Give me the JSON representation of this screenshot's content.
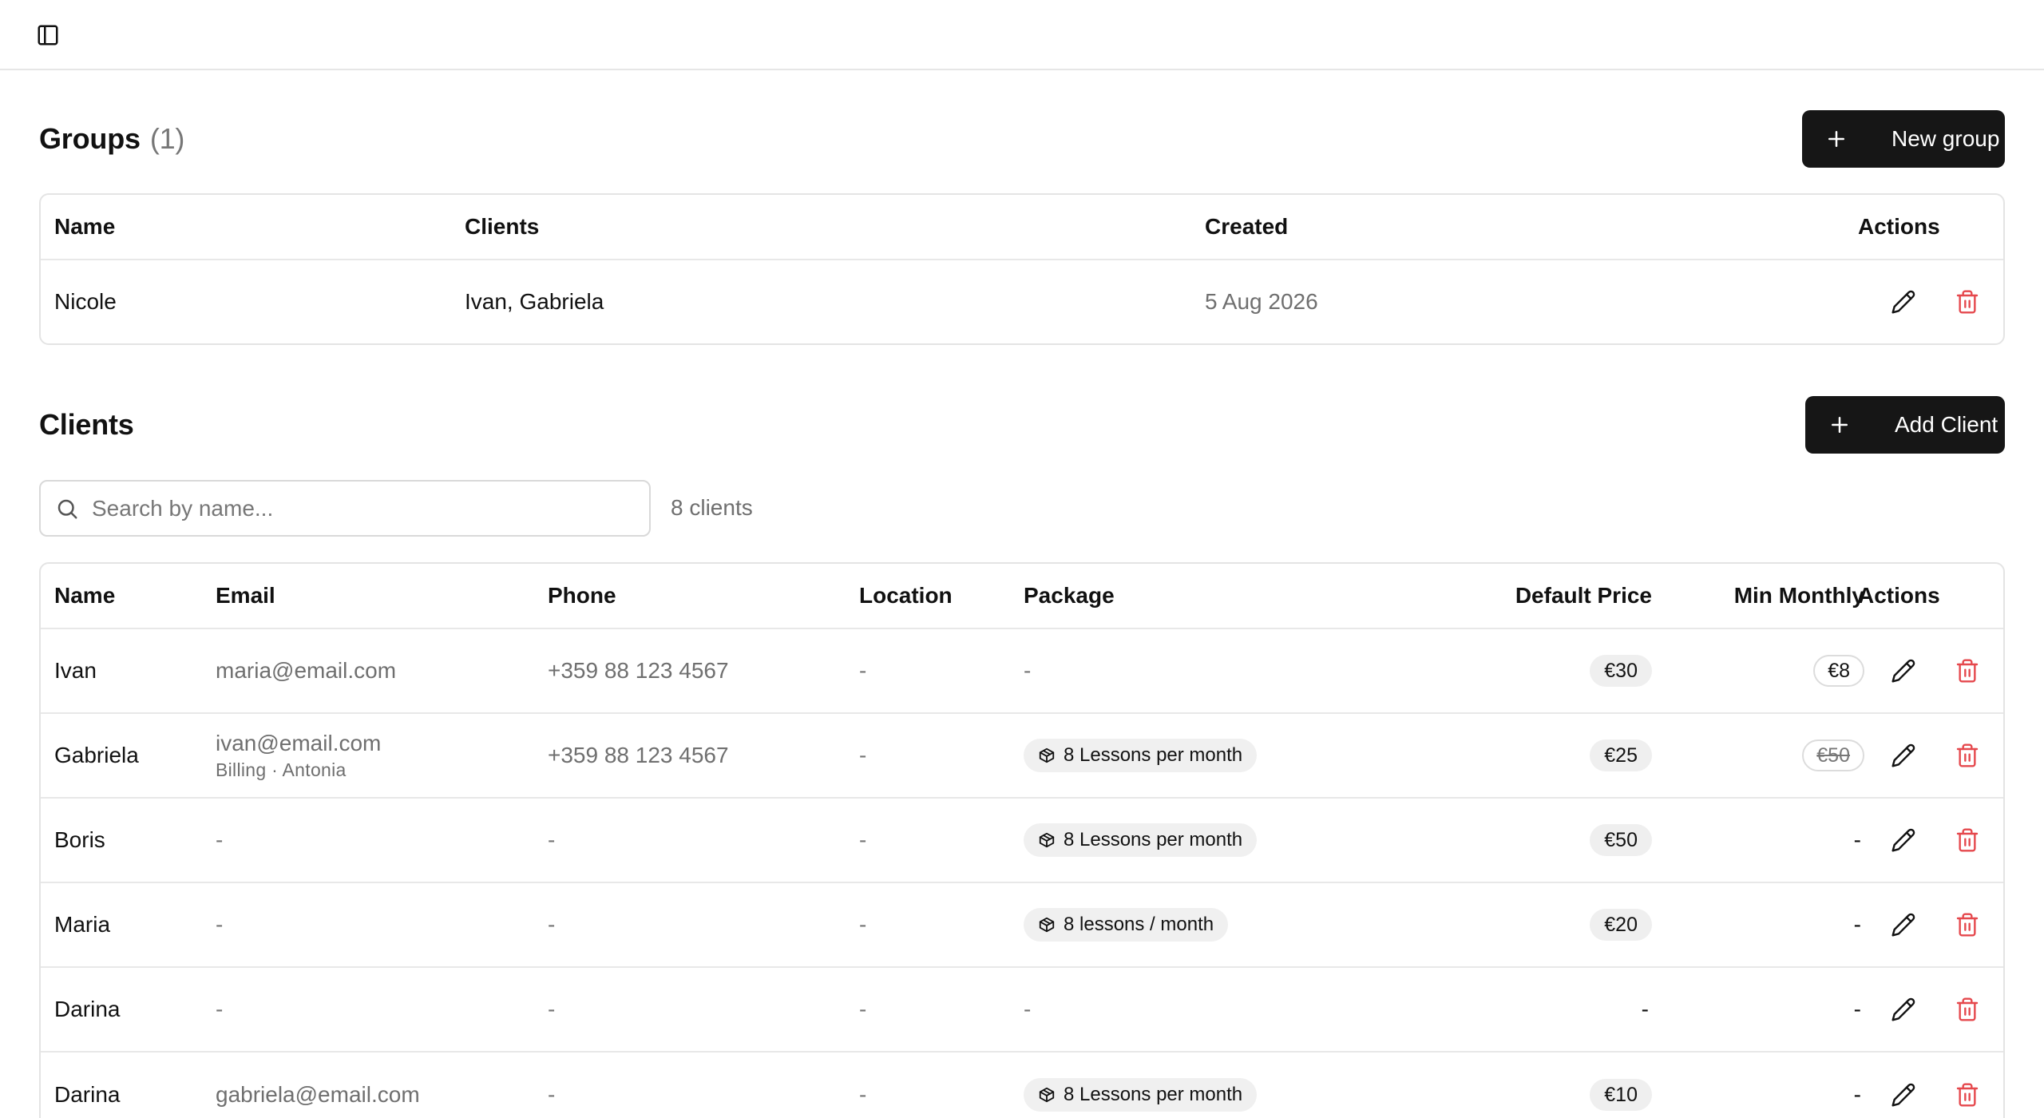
{
  "topbar": {
    "toggle_icon": "sidebar-toggle-icon"
  },
  "groups": {
    "title": "Groups",
    "count": "(1)",
    "new_button": "New group",
    "columns": {
      "name": "Name",
      "clients": "Clients",
      "created": "Created",
      "actions": "Actions"
    },
    "rows": [
      {
        "name": "Nicole",
        "clients": "Ivan, Gabriela",
        "created": "5 Aug 2026"
      }
    ]
  },
  "clients": {
    "title": "Clients",
    "add_button": "Add Client",
    "search_placeholder": "Search by name...",
    "count_label": "8 clients",
    "columns": {
      "name": "Name",
      "email": "Email",
      "phone": "Phone",
      "location": "Location",
      "package": "Package",
      "default_price": "Default Price",
      "min_monthly": "Min Monthly",
      "actions": "Actions"
    },
    "rows": [
      {
        "name": "Ivan",
        "email": "maria@email.com",
        "billing": "",
        "phone": "+359 88 123 4567",
        "location": "-",
        "package": "-",
        "default_price": "€30",
        "min_monthly": "€8",
        "min_monthly_struck": false
      },
      {
        "name": "Gabriela",
        "email": "ivan@email.com",
        "billing": "Billing · Antonia",
        "phone": "+359 88 123 4567",
        "location": "-",
        "package": "8 Lessons per month",
        "default_price": "€25",
        "min_monthly": "€50",
        "min_monthly_struck": true
      },
      {
        "name": "Boris",
        "email": "-",
        "billing": "",
        "phone": "-",
        "location": "-",
        "package": "8 Lessons per month",
        "default_price": "€50",
        "min_monthly": "-",
        "min_monthly_struck": false
      },
      {
        "name": "Maria",
        "email": "-",
        "billing": "",
        "phone": "-",
        "location": "-",
        "package": "8 lessons / month",
        "default_price": "€20",
        "min_monthly": "-",
        "min_monthly_struck": false
      },
      {
        "name": "Darina",
        "email": "-",
        "billing": "",
        "phone": "-",
        "location": "-",
        "package": "-",
        "default_price": "-",
        "min_monthly": "-",
        "min_monthly_struck": false
      },
      {
        "name": "Darina",
        "email": "gabriela@email.com",
        "billing": "",
        "phone": "-",
        "location": "-",
        "package": "8 Lessons per month",
        "default_price": "€10",
        "min_monthly": "-",
        "min_monthly_struck": false
      }
    ]
  },
  "colors": {
    "delete": "#e5484d",
    "button_bg": "#161616",
    "border": "#e4e4e4"
  }
}
